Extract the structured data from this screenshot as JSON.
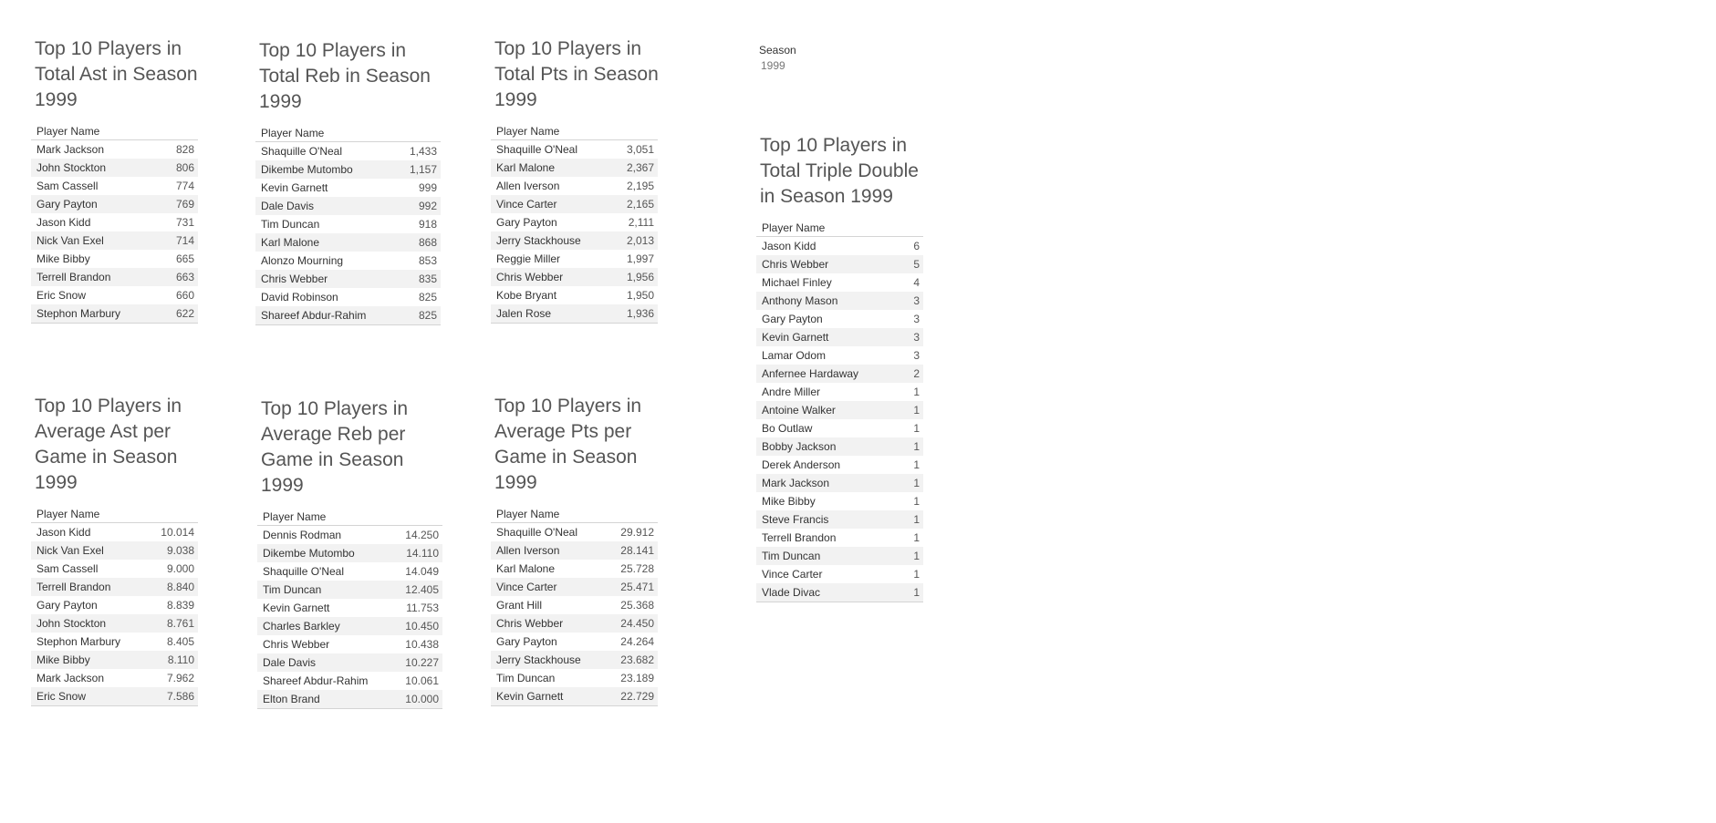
{
  "filter": {
    "label": "Season",
    "value": "1999"
  },
  "column_header": "Player Name",
  "panels": [
    {
      "title": "Top 10 Players in Total Ast in Season 1999",
      "rows": [
        {
          "name": "Mark Jackson",
          "value": "828"
        },
        {
          "name": "John Stockton",
          "value": "806"
        },
        {
          "name": "Sam Cassell",
          "value": "774"
        },
        {
          "name": "Gary Payton",
          "value": "769"
        },
        {
          "name": "Jason Kidd",
          "value": "731"
        },
        {
          "name": "Nick Van Exel",
          "value": "714"
        },
        {
          "name": "Mike Bibby",
          "value": "665"
        },
        {
          "name": "Terrell Brandon",
          "value": "663"
        },
        {
          "name": "Eric Snow",
          "value": "660"
        },
        {
          "name": "Stephon Marbury",
          "value": "622"
        }
      ]
    },
    {
      "title": "Top 10 Players in Total Reb in Season 1999",
      "rows": [
        {
          "name": "Shaquille O'Neal",
          "value": "1,433"
        },
        {
          "name": "Dikembe Mutombo",
          "value": "1,157"
        },
        {
          "name": "Kevin Garnett",
          "value": "999"
        },
        {
          "name": "Dale Davis",
          "value": "992"
        },
        {
          "name": "Tim Duncan",
          "value": "918"
        },
        {
          "name": "Karl Malone",
          "value": "868"
        },
        {
          "name": "Alonzo Mourning",
          "value": "853"
        },
        {
          "name": "Chris Webber",
          "value": "835"
        },
        {
          "name": "David Robinson",
          "value": "825"
        },
        {
          "name": "Shareef Abdur-Rahim",
          "value": "825"
        }
      ]
    },
    {
      "title": "Top 10 Players in Total Pts in Season 1999",
      "rows": [
        {
          "name": "Shaquille O'Neal",
          "value": "3,051"
        },
        {
          "name": "Karl Malone",
          "value": "2,367"
        },
        {
          "name": "Allen Iverson",
          "value": "2,195"
        },
        {
          "name": "Vince Carter",
          "value": "2,165"
        },
        {
          "name": "Gary Payton",
          "value": "2,111"
        },
        {
          "name": "Jerry Stackhouse",
          "value": "2,013"
        },
        {
          "name": "Reggie Miller",
          "value": "1,997"
        },
        {
          "name": "Chris Webber",
          "value": "1,956"
        },
        {
          "name": "Kobe Bryant",
          "value": "1,950"
        },
        {
          "name": "Jalen Rose",
          "value": "1,936"
        }
      ]
    },
    {
      "title": "Top 10 Players in Total Triple Double in Season 1999",
      "rows": [
        {
          "name": "Jason Kidd",
          "value": "6"
        },
        {
          "name": "Chris Webber",
          "value": "5"
        },
        {
          "name": "Michael Finley",
          "value": "4"
        },
        {
          "name": "Anthony Mason",
          "value": "3"
        },
        {
          "name": "Gary Payton",
          "value": "3"
        },
        {
          "name": "Kevin Garnett",
          "value": "3"
        },
        {
          "name": "Lamar Odom",
          "value": "3"
        },
        {
          "name": "Anfernee Hardaway",
          "value": "2"
        },
        {
          "name": "Andre Miller",
          "value": "1"
        },
        {
          "name": "Antoine Walker",
          "value": "1"
        },
        {
          "name": "Bo Outlaw",
          "value": "1"
        },
        {
          "name": "Bobby Jackson",
          "value": "1"
        },
        {
          "name": "Derek Anderson",
          "value": "1"
        },
        {
          "name": "Mark Jackson",
          "value": "1"
        },
        {
          "name": "Mike Bibby",
          "value": "1"
        },
        {
          "name": "Steve Francis",
          "value": "1"
        },
        {
          "name": "Terrell Brandon",
          "value": "1"
        },
        {
          "name": "Tim Duncan",
          "value": "1"
        },
        {
          "name": "Vince Carter",
          "value": "1"
        },
        {
          "name": "Vlade Divac",
          "value": "1"
        }
      ]
    },
    {
      "title": "Top 10 Players in Average Ast per Game in Season 1999",
      "rows": [
        {
          "name": "Jason Kidd",
          "value": "10.014"
        },
        {
          "name": "Nick Van Exel",
          "value": "9.038"
        },
        {
          "name": "Sam Cassell",
          "value": "9.000"
        },
        {
          "name": "Terrell Brandon",
          "value": "8.840"
        },
        {
          "name": "Gary Payton",
          "value": "8.839"
        },
        {
          "name": "John Stockton",
          "value": "8.761"
        },
        {
          "name": "Stephon Marbury",
          "value": "8.405"
        },
        {
          "name": "Mike Bibby",
          "value": "8.110"
        },
        {
          "name": "Mark Jackson",
          "value": "7.962"
        },
        {
          "name": "Eric Snow",
          "value": "7.586"
        }
      ]
    },
    {
      "title": "Top 10 Players in Average Reb per Game in Season 1999",
      "rows": [
        {
          "name": "Dennis Rodman",
          "value": "14.250"
        },
        {
          "name": "Dikembe Mutombo",
          "value": "14.110"
        },
        {
          "name": "Shaquille O'Neal",
          "value": "14.049"
        },
        {
          "name": "Tim Duncan",
          "value": "12.405"
        },
        {
          "name": "Kevin Garnett",
          "value": "11.753"
        },
        {
          "name": "Charles Barkley",
          "value": "10.450"
        },
        {
          "name": "Chris Webber",
          "value": "10.438"
        },
        {
          "name": "Dale Davis",
          "value": "10.227"
        },
        {
          "name": "Shareef Abdur-Rahim",
          "value": "10.061"
        },
        {
          "name": "Elton Brand",
          "value": "10.000"
        }
      ]
    },
    {
      "title": "Top 10 Players in Average Pts per Game in Season 1999",
      "rows": [
        {
          "name": "Shaquille O'Neal",
          "value": "29.912"
        },
        {
          "name": "Allen Iverson",
          "value": "28.141"
        },
        {
          "name": "Karl Malone",
          "value": "25.728"
        },
        {
          "name": "Vince Carter",
          "value": "25.471"
        },
        {
          "name": "Grant Hill",
          "value": "25.368"
        },
        {
          "name": "Chris Webber",
          "value": "24.450"
        },
        {
          "name": "Gary Payton",
          "value": "24.264"
        },
        {
          "name": "Jerry Stackhouse",
          "value": "23.682"
        },
        {
          "name": "Tim Duncan",
          "value": "23.189"
        },
        {
          "name": "Kevin Garnett",
          "value": "22.729"
        }
      ]
    }
  ]
}
